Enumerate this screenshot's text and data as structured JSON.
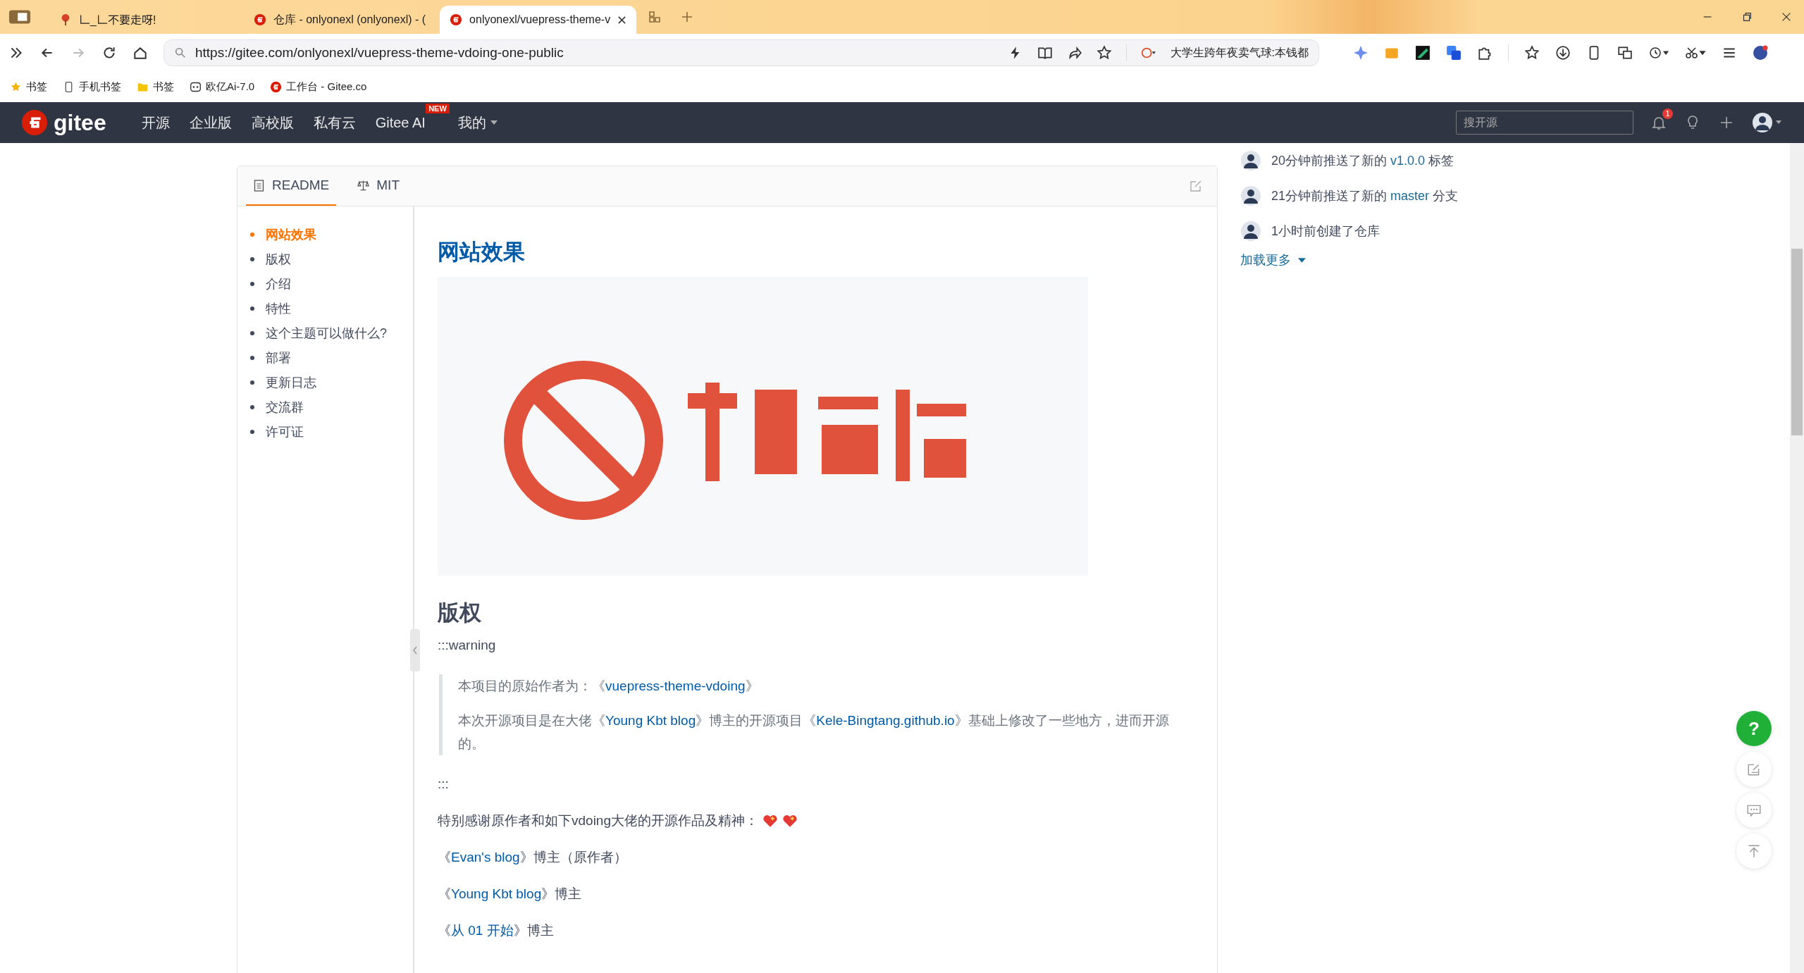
{
  "browser": {
    "tabs": [
      {
        "title": "𠃊_𠃊不要走呀!",
        "selected": false
      },
      {
        "title": "仓库 - onlyonexl (onlyonexl) - (",
        "selected": false
      },
      {
        "title": "onlyonexl/vuepress-theme-v",
        "selected": true
      }
    ],
    "url": "https://gitee.com/onlyonexl/vuepress-theme-vdoing-one-public",
    "search_text": "大学生跨年夜卖气球:本钱都",
    "bookmarks": [
      {
        "label": "书签"
      },
      {
        "label": "手机书签"
      },
      {
        "label": "书签"
      },
      {
        "label": "欧亿Ai-7.0"
      },
      {
        "label": "工作台 - Gitee.co"
      }
    ]
  },
  "nav": {
    "logo": "gitee",
    "items": [
      {
        "label": "开源"
      },
      {
        "label": "企业版"
      },
      {
        "label": "高校版"
      },
      {
        "label": "私有云"
      },
      {
        "label": "Gitee AI",
        "badge": "NEW"
      }
    ],
    "mine": "我的",
    "search": {
      "placeholder": "搜开源"
    },
    "notifications": "1"
  },
  "readme": {
    "tabs": [
      {
        "label": "README",
        "selected": true
      },
      {
        "label": "MIT",
        "selected": false
      }
    ],
    "toc": [
      {
        "label": "网站效果",
        "selected": true
      },
      {
        "label": "版权",
        "selected": false
      },
      {
        "label": "介绍",
        "selected": false
      },
      {
        "label": "特性",
        "selected": false
      },
      {
        "label": "这个主题可以做什么?",
        "selected": false
      },
      {
        "label": "部署",
        "selected": false
      },
      {
        "label": "更新日志",
        "selected": false
      },
      {
        "label": "交流群",
        "selected": false
      },
      {
        "label": "许可证",
        "selected": false
      }
    ],
    "blocks": [
      {
        "kind": "h",
        "text": "网站效果"
      },
      {
        "kind": "picture"
      },
      {
        "kind": "h",
        "text": "版权"
      },
      {
        "kind": "p",
        "segments": [
          {
            "kind": "text",
            "text": ":::warning"
          }
        ]
      },
      {
        "kind": "quote",
        "paragraphs": [
          [
            {
              "kind": "text",
              "text": "本项目的原始作者为：《"
            },
            {
              "kind": "link",
              "text": "vuepress-theme-vdoing"
            },
            {
              "kind": "text",
              "text": "》"
            }
          ],
          [
            {
              "kind": "text",
              "text": "本次开源项目是在大佬《"
            },
            {
              "kind": "link",
              "text": "Young Kbt blog"
            },
            {
              "kind": "text",
              "text": "》博主的开源项目《"
            },
            {
              "kind": "link",
              "text": "Kele-Bingtang.github.io"
            },
            {
              "kind": "text",
              "text": "》基础上修改了一些地方，进而开源的。"
            }
          ]
        ]
      },
      {
        "kind": "p",
        "segments": [
          {
            "kind": "text",
            "text": ":::"
          }
        ]
      },
      {
        "kind": "hearts",
        "segments": [
          {
            "kind": "text",
            "text": "特别感谢原作者和如下vdoing大佬的开源作品及精神："
          }
        ]
      },
      {
        "kind": "p",
        "segments": [
          {
            "kind": "text",
            "text": "《"
          },
          {
            "kind": "link",
            "text": "Evan's blog"
          },
          {
            "kind": "text",
            "text": "》博主（原作者）"
          }
        ]
      },
      {
        "kind": "p",
        "segments": [
          {
            "kind": "text",
            "text": "《"
          },
          {
            "kind": "link",
            "text": "Young Kbt blog"
          },
          {
            "kind": "text",
            "text": "》博主"
          }
        ]
      },
      {
        "kind": "p",
        "segments": [
          {
            "kind": "text",
            "text": "《"
          },
          {
            "kind": "link",
            "text": "从 01 开始"
          },
          {
            "kind": "text",
            "text": "》博主"
          }
        ]
      }
    ]
  },
  "activity": {
    "items": [
      [
        {
          "kind": "text",
          "text": "20分钟前推送了新的 "
        },
        {
          "kind": "link",
          "text": "v1.0.0"
        },
        {
          "kind": "text",
          "text": " 标签"
        }
      ],
      [
        {
          "kind": "text",
          "text": "21分钟前推送了新的 "
        },
        {
          "kind": "link",
          "text": "master"
        },
        {
          "kind": "text",
          "text": " 分支"
        }
      ],
      [
        {
          "kind": "text",
          "text": "1小时前创建了仓库"
        }
      ]
    ],
    "load_more": "加载更多"
  },
  "float_buttons": [
    {
      "kind": "help",
      "text": "?"
    },
    {
      "kind": "edit"
    },
    {
      "kind": "comment"
    },
    {
      "kind": "top"
    }
  ]
}
